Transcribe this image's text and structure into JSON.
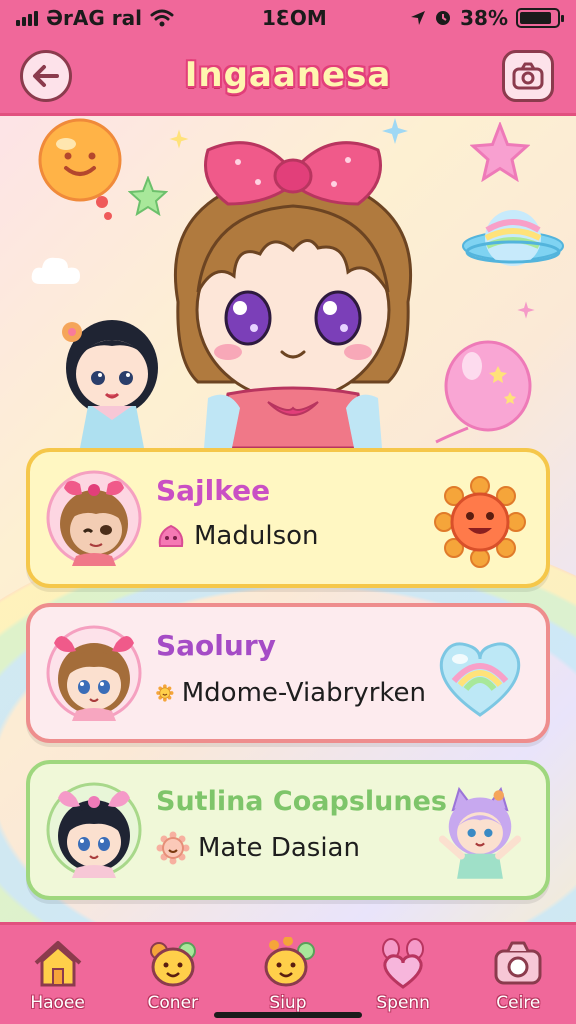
{
  "status_bar": {
    "carrier": "ƏrAG ral",
    "time": "1ƐOM",
    "battery_percent": "38%",
    "battery_level": 0.85
  },
  "header": {
    "title": "Ingaanesa",
    "back_icon": "arrow-left-icon",
    "camera_icon": "camera-icon"
  },
  "cards": [
    {
      "name": "Sajlkee",
      "subtitle": "Madulson",
      "avatar": "girl-brown-hair-bow",
      "right_icon": "smiling-sun-icon"
    },
    {
      "name": "Saolury",
      "subtitle": "Mdome-Viabryrken",
      "avatar": "girl-brown-hair-pink-bow",
      "right_icon": "rainbow-heart-icon"
    },
    {
      "name": "Sutlina Coapslunes",
      "subtitle": "Mate Dasian",
      "avatar": "girl-black-hair-bow",
      "right_icon": "lavender-catgirl-icon"
    }
  ],
  "bottom_nav": [
    {
      "label": "Haoee",
      "icon": "house-icon"
    },
    {
      "label": "Coner",
      "icon": "bear-face-icon"
    },
    {
      "label": "Siup",
      "icon": "sun-face-icon"
    },
    {
      "label": "Spenn",
      "icon": "bunny-heart-icon"
    },
    {
      "label": "Ceire",
      "icon": "camera-icon"
    }
  ],
  "colors": {
    "header_pink": "#f0689a",
    "title_fill": "#fff6b0",
    "card1_border": "#f5c74a",
    "card2_border": "#ee8d8d",
    "card3_border": "#9fd77e"
  }
}
